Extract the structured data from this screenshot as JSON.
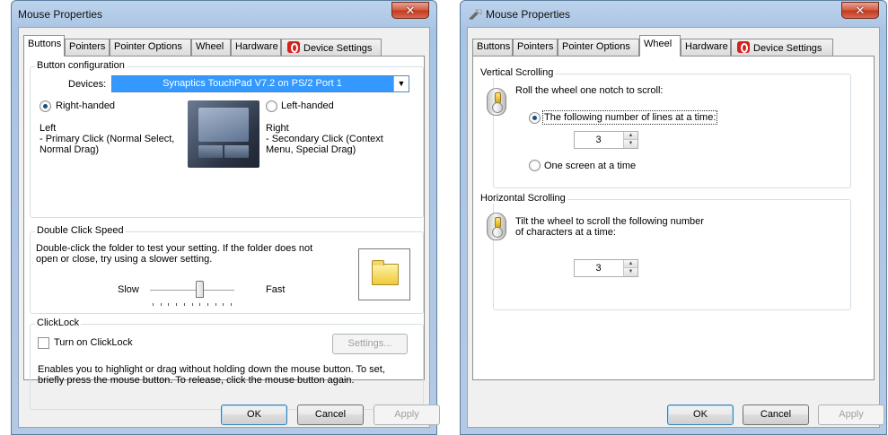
{
  "colors": {
    "title_bar": "#b4cae4",
    "close_button": "#c2381b",
    "selection": "#3399ff",
    "dialog_bg": "#f0f0f0",
    "device_settings_icon": "#d6221e"
  },
  "left": {
    "window": {
      "title": "Mouse Properties",
      "close_glyph": "✕"
    },
    "tabs": [
      {
        "label": "Buttons",
        "selected": true
      },
      {
        "label": "Pointers",
        "selected": false
      },
      {
        "label": "Pointer Options",
        "selected": false
      },
      {
        "label": "Wheel",
        "selected": false
      },
      {
        "label": "Hardware",
        "selected": false
      },
      {
        "label": "Device Settings",
        "selected": false,
        "icon": "device-settings-icon"
      }
    ],
    "button_config": {
      "group_label": "Button configuration",
      "devices_label": "Devices:",
      "devices_value": "Synaptics TouchPad V7.2 on PS/2 Port 1",
      "right_handed_label": "Right-handed",
      "left_handed_label": "Left-handed",
      "handedness_selected": "right-handed",
      "left_col_title": "Left",
      "left_col_line1": " - Primary Click (Normal Select,",
      "left_col_line2": "Normal Drag)",
      "right_col_title": "Right",
      "right_col_line1": " - Secondary Click (Context",
      "right_col_line2": "Menu, Special Drag)",
      "image": "touchpad-image"
    },
    "double_click": {
      "group_label": "Double Click Speed",
      "desc_line1": "Double-click the folder to test your setting.  If the folder does not",
      "desc_line2": "open or close, try using a slower setting.",
      "slow_label": "Slow",
      "fast_label": "Fast",
      "speed_fraction": 0.6,
      "tick_count": 11,
      "test_icon": "folder-icon"
    },
    "clicklock": {
      "group_label": "ClickLock",
      "checkbox_label": "Turn on ClickLock",
      "checked": false,
      "settings_label": "Settings...",
      "desc_line1": "Enables you to highlight or drag without holding down the mouse button.  To set,",
      "desc_line2": "briefly press the mouse button.  To release, click the mouse button again."
    },
    "buttons": {
      "ok": "OK",
      "cancel": "Cancel",
      "apply": "Apply"
    }
  },
  "right": {
    "window": {
      "title": "Mouse Properties",
      "close_glyph": "✕",
      "icon": "mouse-app-icon"
    },
    "tabs": [
      {
        "label": "Buttons",
        "selected": false
      },
      {
        "label": "Pointers",
        "selected": false
      },
      {
        "label": "Pointer Options",
        "selected": false
      },
      {
        "label": "Wheel",
        "selected": true
      },
      {
        "label": "Hardware",
        "selected": false
      },
      {
        "label": "Device Settings",
        "selected": false,
        "icon": "device-settings-icon"
      }
    ],
    "vertical": {
      "group_label": "Vertical Scrolling",
      "prompt": "Roll the wheel one notch to scroll:",
      "option_lines": "The following number of lines at a time:",
      "lines_value": "3",
      "option_screen": "One screen at a time",
      "selected": "lines",
      "icon": "mouse-wheel-icon"
    },
    "horizontal": {
      "group_label": "Horizontal Scrolling",
      "prompt_line1": "Tilt the wheel to scroll the following number",
      "prompt_line2": "of characters at a time:",
      "chars_value": "3",
      "icon": "mouse-wheel-tilt-icon"
    },
    "buttons": {
      "ok": "OK",
      "cancel": "Cancel",
      "apply": "Apply"
    }
  }
}
